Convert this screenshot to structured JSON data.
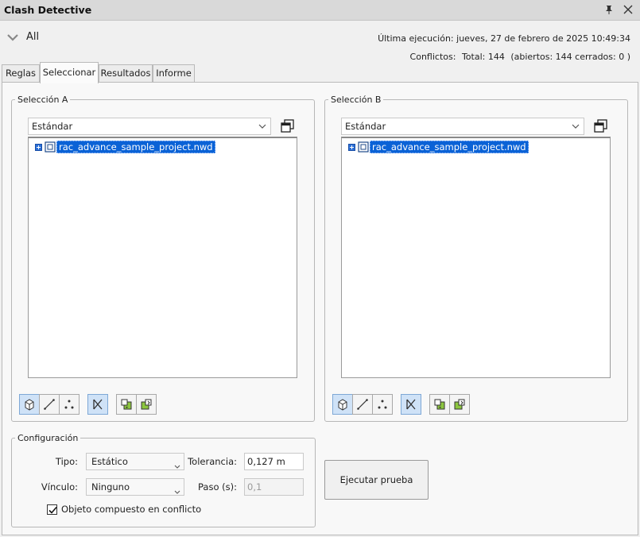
{
  "window": {
    "title": "Clash Detective",
    "pin_icon": "pin-icon",
    "close_icon": "close-icon"
  },
  "header": {
    "test_name": "All",
    "last_run_label": "Última ejecución:",
    "last_run_value": "jueves, 27 de febrero de 2025 10:49:34",
    "conflicts_label": "Conflictos:",
    "conflicts_total": "Total:  144",
    "conflicts_detail": "(abiertos:  144  cerrados:  0 )"
  },
  "tabs": [
    {
      "label": "Reglas",
      "active": false
    },
    {
      "label": "Seleccionar",
      "active": true
    },
    {
      "label": "Resultados",
      "active": false
    },
    {
      "label": "Informe",
      "active": false
    }
  ],
  "selection_a": {
    "title": "Selección A",
    "dropdown_value": "Estándar",
    "tree_items": [
      {
        "label": "rac_advance_sample_project.nwd",
        "selected": true
      }
    ]
  },
  "selection_b": {
    "title": "Selección B",
    "dropdown_value": "Estándar",
    "tree_items": [
      {
        "label": "rac_advance_sample_project.nwd",
        "selected": true
      }
    ]
  },
  "toolbar_icons": [
    "surfaces-icon",
    "lines-icon",
    "points-icon",
    "self-intersect-icon",
    "use-current-selection-icon",
    "select-in-scene-icon"
  ],
  "configuration": {
    "title": "Configuración",
    "type_label": "Tipo:",
    "type_value": "Estático",
    "tolerance_label": "Tolerancia:",
    "tolerance_value": "0,127 m",
    "link_label": "Vínculo:",
    "link_value": "Ninguno",
    "step_label": "Paso (s):",
    "step_value": "0,1",
    "composite_label": "Objeto compuesto en conflicto",
    "composite_checked": true
  },
  "run_button": "Ejecutar prueba",
  "colors": {
    "selection_highlight": "#0a62d6",
    "toggle_active": "#cfe2f7"
  }
}
